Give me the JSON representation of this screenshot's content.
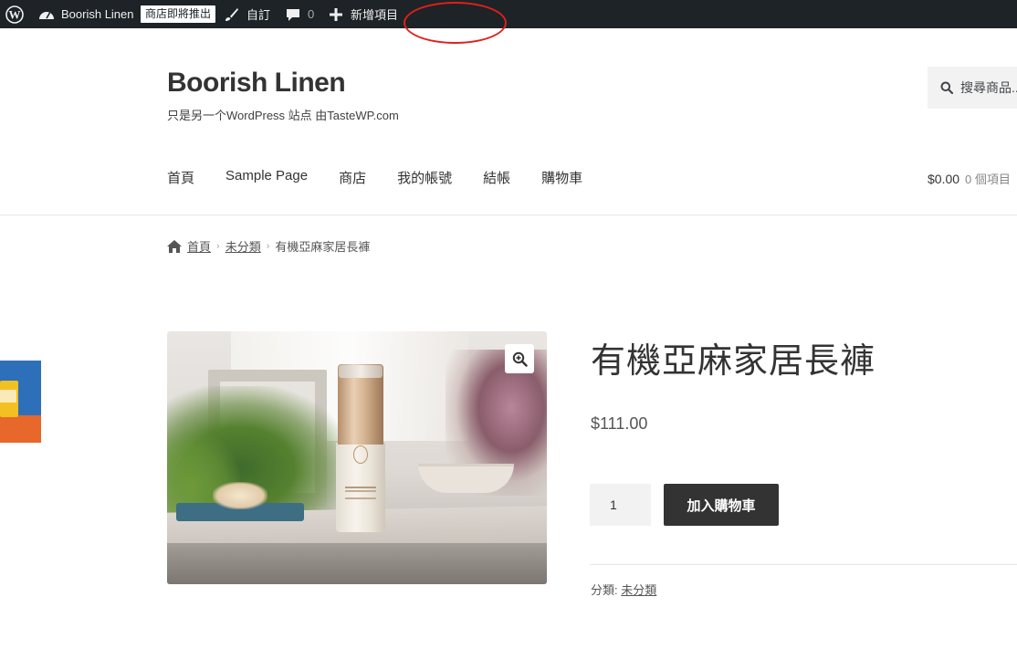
{
  "admin_bar": {
    "site_name": "Boorish Linen",
    "badge": "商店即將推出",
    "customize": "自訂",
    "comments_count": "0",
    "new_item": "新增項目",
    "icons": [
      "wordpress-icon",
      "dashboard-icon",
      "brush-icon",
      "comment-icon",
      "plus-icon"
    ]
  },
  "header": {
    "title": "Boorish Linen",
    "description": "只是另一个WordPress 站点 由TasteWP.com",
    "search_placeholder": "搜尋商品..."
  },
  "nav": {
    "items": [
      "首頁",
      "Sample Page",
      "商店",
      "我的帳號",
      "結帳",
      "購物車"
    ]
  },
  "cart": {
    "amount": "$0.00",
    "items": "0 個項目"
  },
  "breadcrumb": {
    "home": "首頁",
    "category": "未分類",
    "current": "有機亞麻家居長褲"
  },
  "product": {
    "title": "有機亞麻家居長褲",
    "price": "$111.00",
    "quantity": "1",
    "add_to_cart": "加入購物車",
    "category_label": "分類:",
    "category": "未分類"
  },
  "colors": {
    "admin_bar_bg": "#1d2327",
    "button_bg": "#333333",
    "annotation": "#e0201b"
  }
}
